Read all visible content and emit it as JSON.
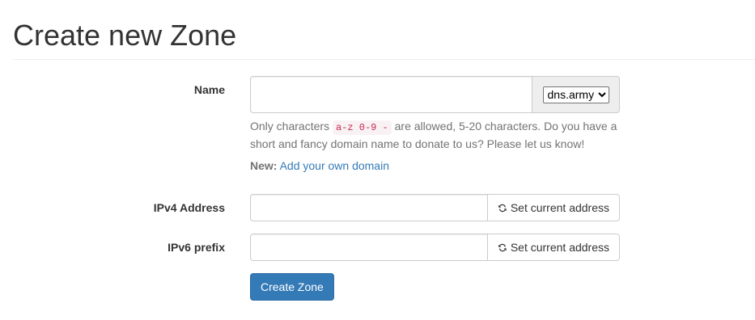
{
  "page": {
    "title": "Create new Zone"
  },
  "form": {
    "name": {
      "label": "Name",
      "value": "",
      "domain_selected": "dns.army",
      "domain_options": [
        "dns.army"
      ]
    },
    "help": {
      "prefix": "Only characters ",
      "code": "a-z 0-9 -",
      "suffix": " are allowed, 5-20 characters. Do you have a short and fancy domain name to donate to us? Please let us know!"
    },
    "new_domain": {
      "label": "New:",
      "link_text": "Add your own domain"
    },
    "ipv4": {
      "label": "IPv4 Address",
      "value": "",
      "button_label": "Set current address"
    },
    "ipv6": {
      "label": "IPv6 prefix",
      "value": "",
      "button_label": "Set current address"
    },
    "submit_label": "Create Zone"
  },
  "colors": {
    "primary": "#337ab7",
    "link": "#337ab7",
    "code_text": "#c7254e",
    "code_bg": "#f9f2f4",
    "help_text": "#737373"
  },
  "icons": {
    "refresh": "refresh-icon"
  }
}
